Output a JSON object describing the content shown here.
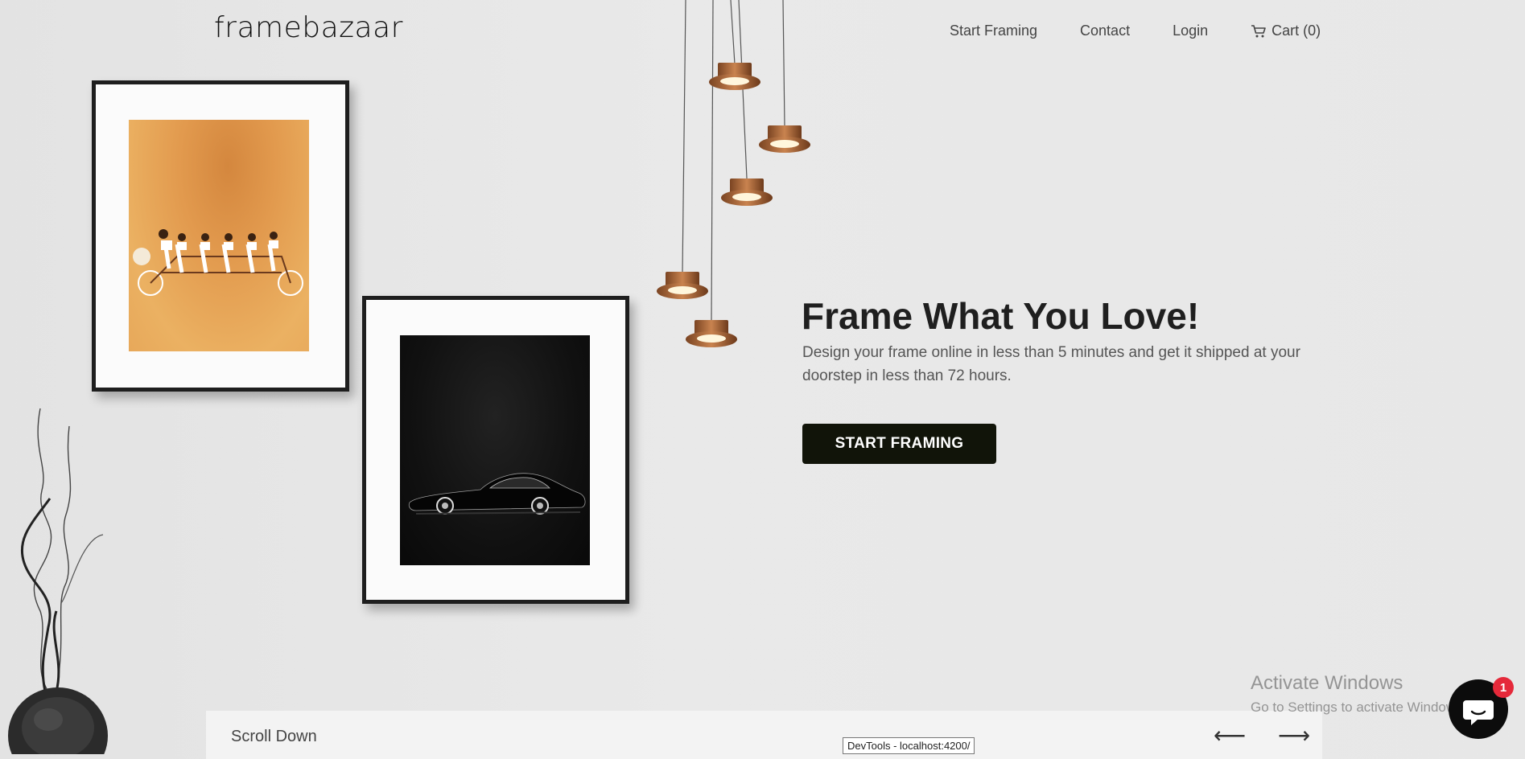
{
  "brand": {
    "logo_text": "framebazaar"
  },
  "nav": {
    "items": [
      {
        "label": "Start Framing"
      },
      {
        "label": "Contact"
      },
      {
        "label": "Login"
      },
      {
        "label": "Cart (0)",
        "icon": "cart-icon"
      }
    ]
  },
  "hero": {
    "title": "Frame What You Love!",
    "subtitle": "Design your frame online in less than 5 minutes and get it shipped at your doorstep in less than 72 hours.",
    "cta_label": "START FRAMING"
  },
  "bottom_bar": {
    "label": "Scroll Down",
    "prev_arrow": "⟵",
    "next_arrow": "⟶"
  },
  "tooltip": {
    "text": "DevTools - localhost:4200/"
  },
  "windows_watermark": {
    "title": "Activate Windows",
    "subtitle": "Go to Settings to activate Windows."
  },
  "chat_widget": {
    "badge_count": "1",
    "icon": "chat-icon"
  },
  "colors": {
    "background": "#e7e7e7",
    "cta_background": "#111409",
    "lamp_copper": "#b5703f",
    "badge": "#e5293a"
  }
}
